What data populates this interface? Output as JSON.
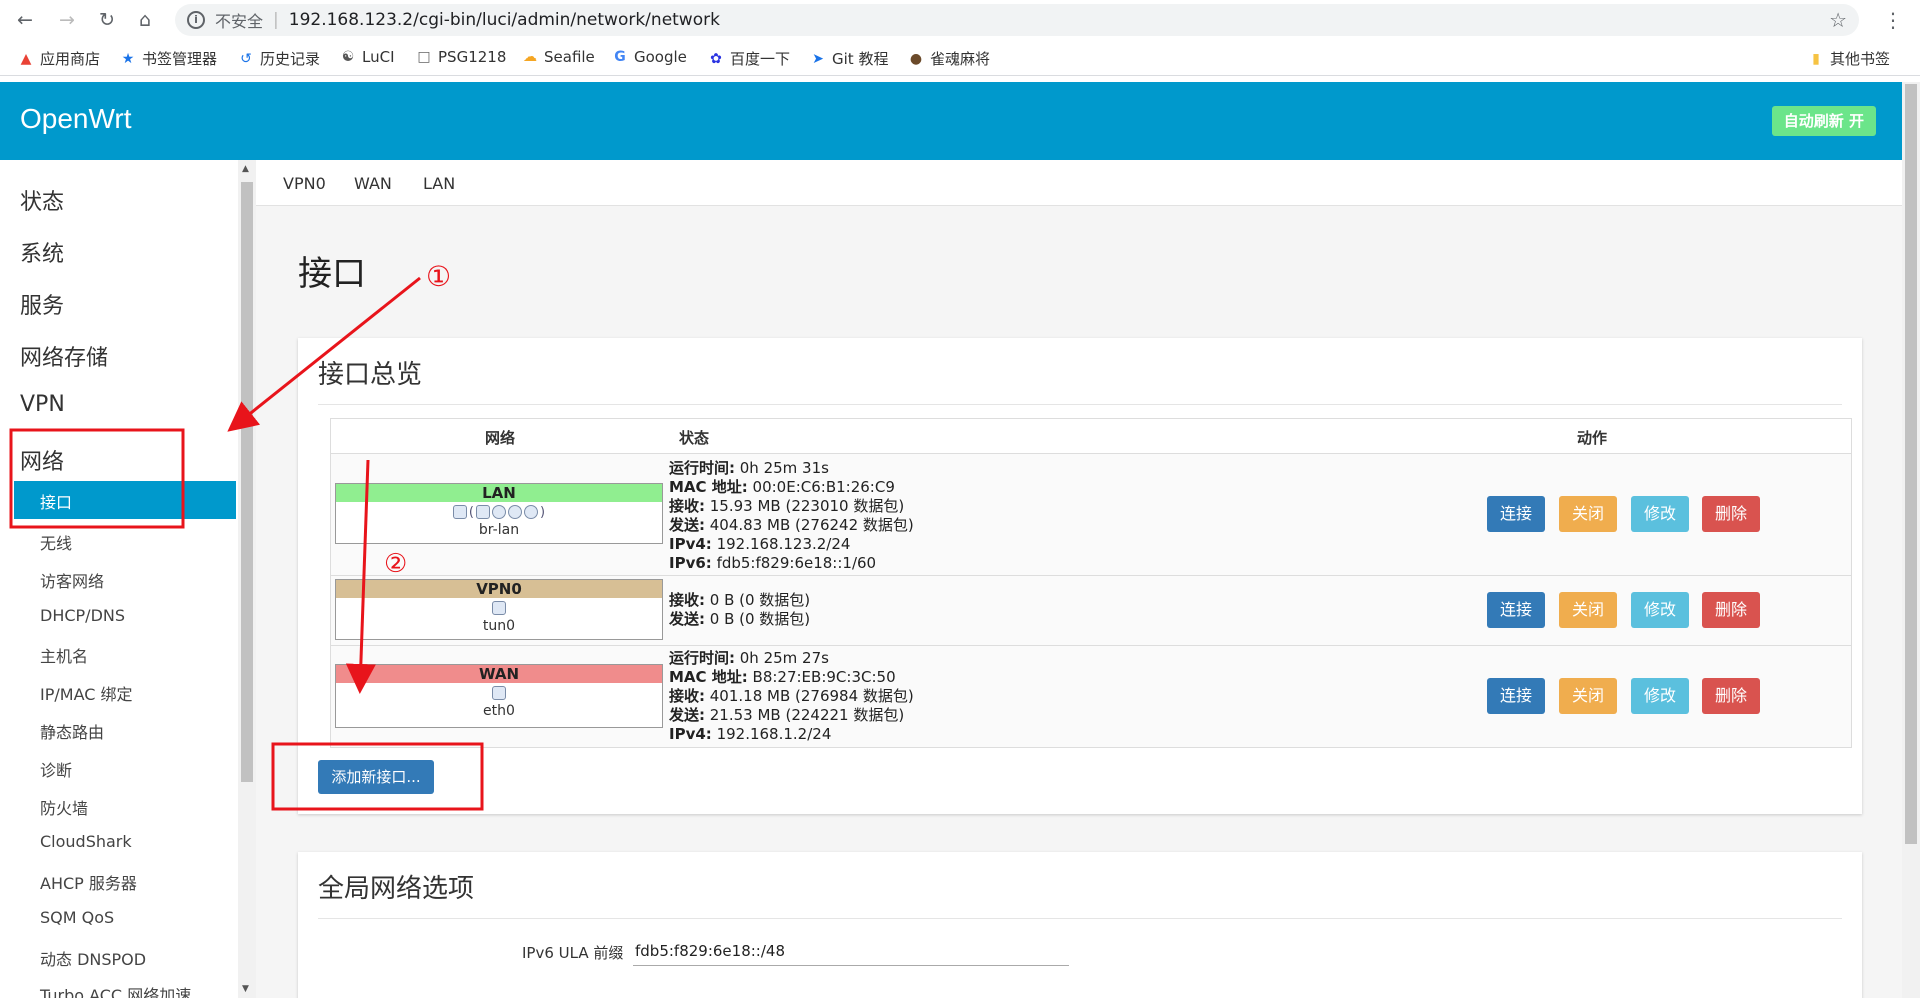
{
  "browser": {
    "security_label": "不安全",
    "url": "192.168.123.2/cgi-bin/luci/admin/network/network",
    "bookmarks": [
      "应用商店",
      "书签管理器",
      "历史记录",
      "LuCI",
      "PSG1218",
      "Seafile",
      "Google",
      "百度一下",
      "Git 教程",
      "雀魂麻将"
    ],
    "other_bookmarks": "其他书签"
  },
  "header": {
    "brand": "OpenWrt",
    "autorefresh": "自动刷新 开"
  },
  "sidebar": {
    "main_items": [
      "状态",
      "系统",
      "服务",
      "网络存储",
      "VPN",
      "网络"
    ],
    "active_sub": "接口",
    "sub_items": [
      "无线",
      "访客网络",
      "DHCP/DNS",
      "主机名",
      "IP/MAC 绑定",
      "静态路由",
      "诊断",
      "防火墙",
      "CloudShark",
      "AHCP 服务器",
      "SQM QoS",
      "动态 DNSPOD",
      "Turbo ACC 网络加速"
    ]
  },
  "tabs": [
    "VPN0",
    "WAN",
    "LAN"
  ],
  "page_title": "接口",
  "overview": {
    "heading": "接口总览",
    "columns": {
      "network": "网络",
      "status": "状态",
      "actions": "动作"
    },
    "rows": [
      {
        "name": "LAN",
        "band_color": "#90ee90",
        "device": "br-lan",
        "status": [
          {
            "k": "运行时间:",
            "v": " 0h 25m 31s"
          },
          {
            "k": "MAC 地址:",
            "v": " 00:0E:C6:B1:26:C9"
          },
          {
            "k": "接收:",
            "v": " 15.93 MB (223010 数据包)"
          },
          {
            "k": "发送:",
            "v": " 404.83 MB (276242 数据包)"
          },
          {
            "k": "IPv4:",
            "v": " 192.168.123.2/24"
          },
          {
            "k": "IPv6:",
            "v": " fdb5:f829:6e18::1/60"
          }
        ]
      },
      {
        "name": "VPN0",
        "band_color": "#d7bf95",
        "device": "tun0",
        "status": [
          {
            "k": "接收:",
            "v": " 0 B (0 数据包)"
          },
          {
            "k": "发送:",
            "v": " 0 B (0 数据包)"
          }
        ]
      },
      {
        "name": "WAN",
        "band_color": "#f08c8c",
        "device": "eth0",
        "status": [
          {
            "k": "运行时间:",
            "v": " 0h 25m 27s"
          },
          {
            "k": "MAC 地址:",
            "v": " B8:27:EB:9C:3C:50"
          },
          {
            "k": "接收:",
            "v": " 401.18 MB (276984 数据包)"
          },
          {
            "k": "发送:",
            "v": " 21.53 MB (224221 数据包)"
          },
          {
            "k": "IPv4:",
            "v": " 192.168.1.2/24"
          }
        ]
      }
    ],
    "buttons": {
      "connect": "连接",
      "stop": "关闭",
      "edit": "修改",
      "delete": "删除"
    },
    "add_button": "添加新接口..."
  },
  "global": {
    "heading": "全局网络选项",
    "ula_label": "IPv6 ULA 前缀",
    "ula_value": "fdb5:f829:6e18::/48"
  },
  "annotations": {
    "marker1": "①",
    "marker2": "②",
    "color": "#e8141b"
  }
}
